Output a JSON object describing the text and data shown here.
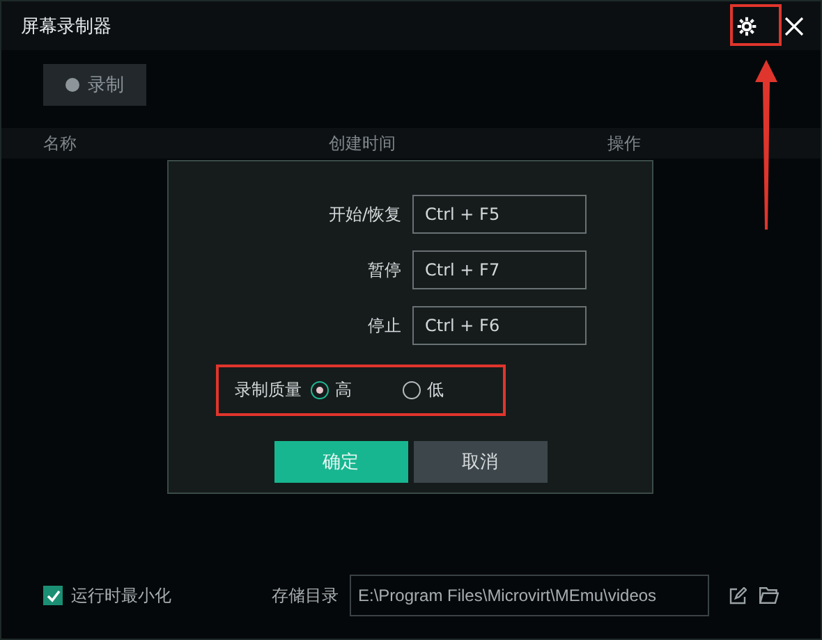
{
  "window": {
    "title": "屏幕录制器"
  },
  "record_button": {
    "label": "录制"
  },
  "table": {
    "columns": [
      "名称",
      "创建时间",
      "操作"
    ]
  },
  "dialog": {
    "hotkeys": [
      {
        "label": "开始/恢复",
        "value": "Ctrl + F5"
      },
      {
        "label": "暂停",
        "value": "Ctrl + F7"
      },
      {
        "label": "停止",
        "value": "Ctrl + F6"
      }
    ],
    "quality": {
      "label": "录制质量",
      "options": [
        {
          "label": "高",
          "selected": true
        },
        {
          "label": "低",
          "selected": false
        }
      ]
    },
    "buttons": [
      {
        "label": "确定",
        "kind": "primary"
      },
      {
        "label": "取消",
        "kind": "secondary"
      }
    ]
  },
  "footer": {
    "minimize": {
      "label": "运行时最小化",
      "checked": true
    },
    "storage": {
      "label": "存储目录",
      "value": "E:\\Program Files\\Microvirt\\MEmu\\videos"
    }
  }
}
